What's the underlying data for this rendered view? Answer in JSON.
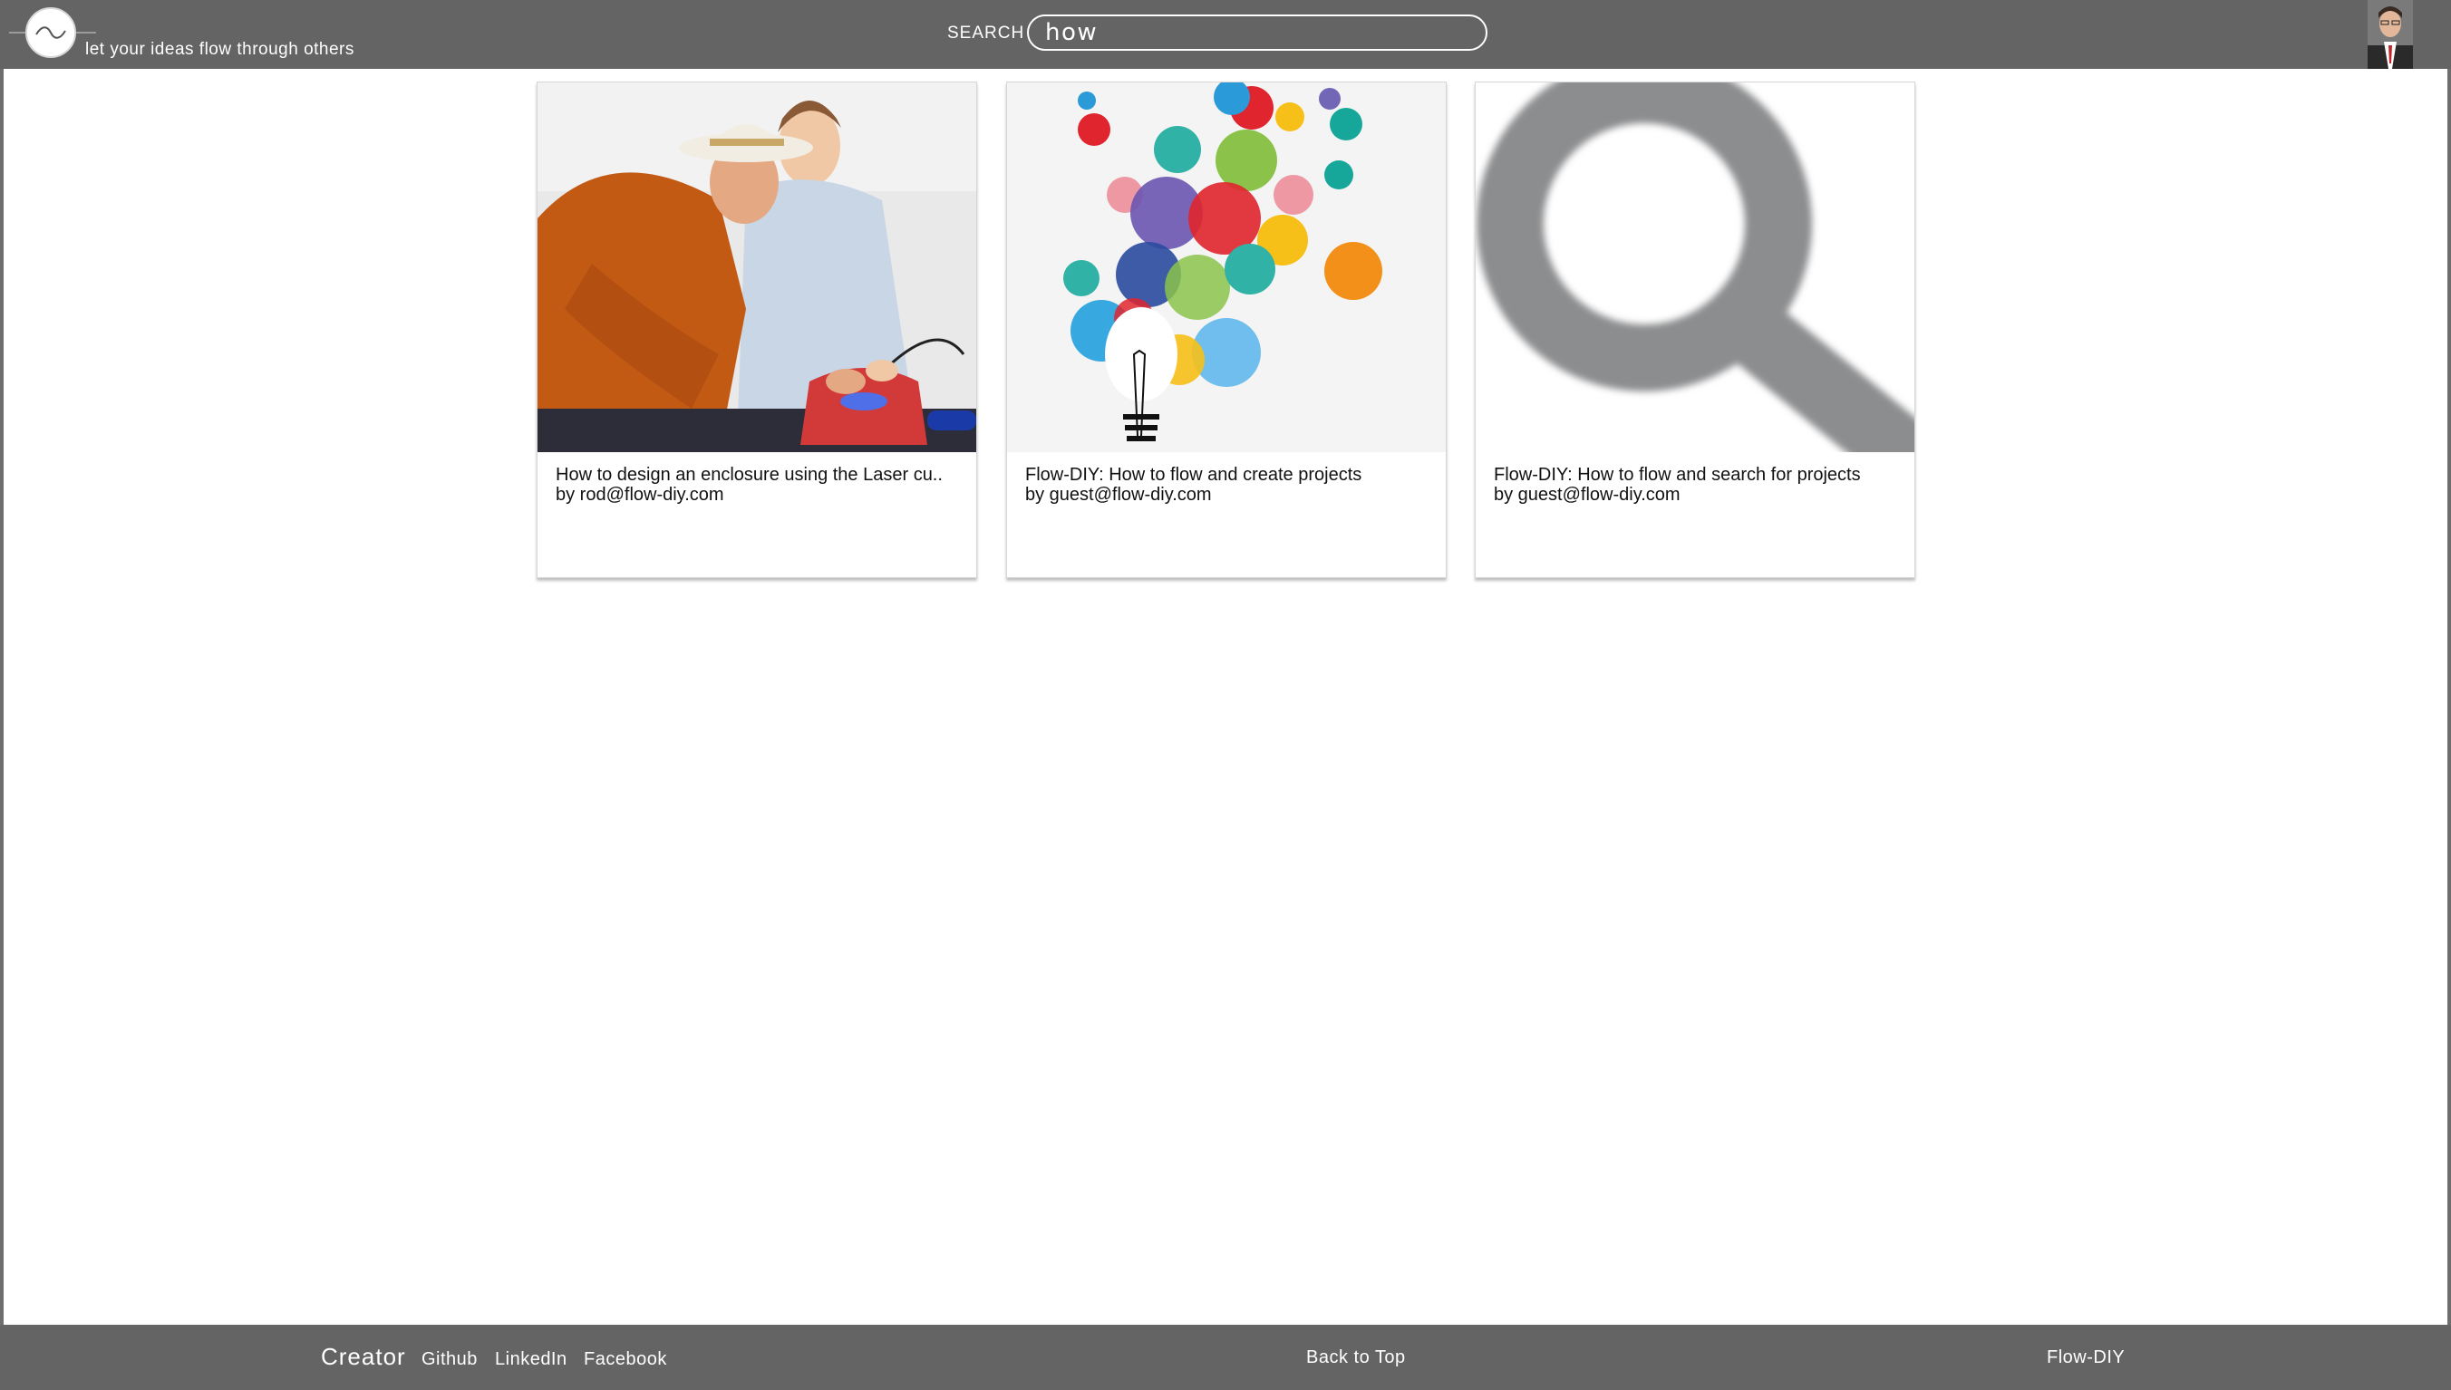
{
  "header": {
    "tagline": "let your ideas flow through others",
    "search_label": "SEARCH",
    "search_value": "how"
  },
  "results": [
    {
      "title": "How to design an enclosure using the Laser cu..",
      "author": "by rod@flow-diy.com",
      "image": "photo-two-men-working-on-electronics"
    },
    {
      "title": "Flow-DIY: How to flow and create projects",
      "author": "by guest@flow-diy.com",
      "image": "lightbulb-with-colorful-circles"
    },
    {
      "title": "Flow-DIY: How to flow and search for projects",
      "author": "by guest@flow-diy.com",
      "image": "magnifying-glass-icon"
    }
  ],
  "footer": {
    "creator": "Creator",
    "github": "Github",
    "linkedin": "LinkedIn",
    "facebook": "Facebook",
    "back_to_top": "Back to Top",
    "brand": "Flow-DIY"
  },
  "colors": {
    "bar": "#646464",
    "background": "#ffffff",
    "text": "#111111"
  }
}
